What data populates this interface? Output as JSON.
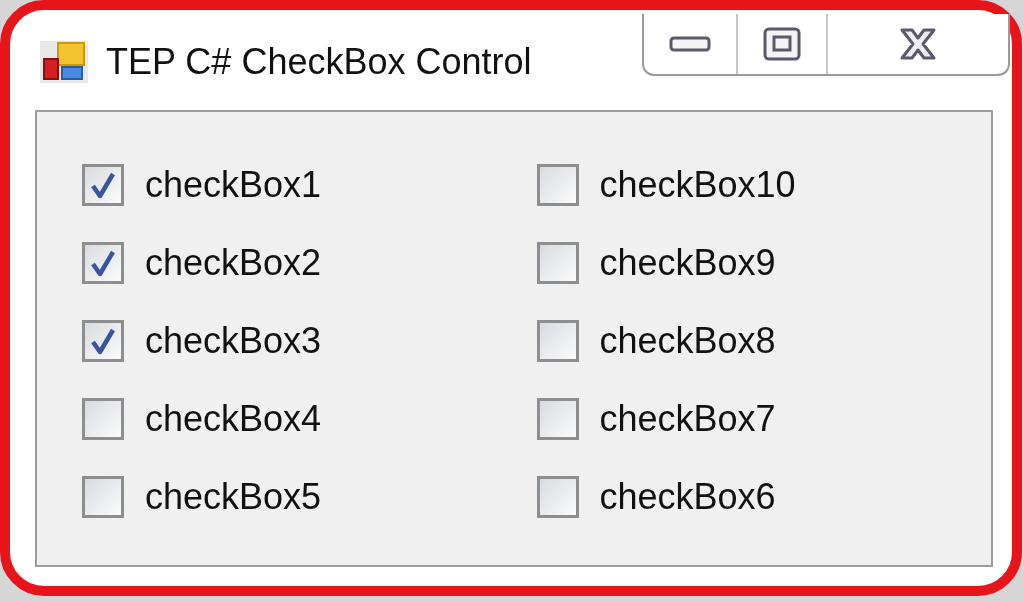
{
  "window": {
    "title": "TEP C# CheckBox Control"
  },
  "checkbox_columns": [
    [
      {
        "label": "checkBox1",
        "checked": true
      },
      {
        "label": "checkBox2",
        "checked": true
      },
      {
        "label": "checkBox3",
        "checked": true
      },
      {
        "label": "checkBox4",
        "checked": false
      },
      {
        "label": "checkBox5",
        "checked": false
      }
    ],
    [
      {
        "label": "checkBox10",
        "checked": false
      },
      {
        "label": "checkBox9",
        "checked": false
      },
      {
        "label": "checkBox8",
        "checked": false
      },
      {
        "label": "checkBox7",
        "checked": false
      },
      {
        "label": "checkBox6",
        "checked": false
      }
    ]
  ]
}
